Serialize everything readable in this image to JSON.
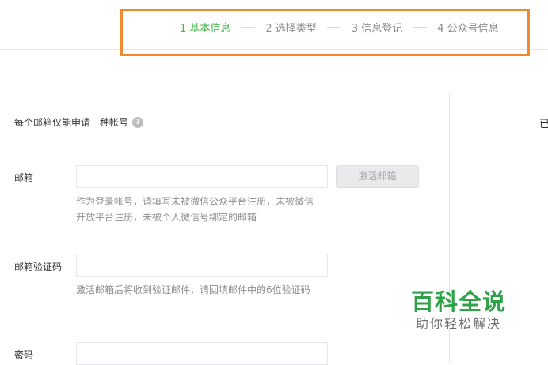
{
  "steps": [
    {
      "label": "1 基本信息",
      "active": true
    },
    {
      "label": "2 选择类型",
      "active": false
    },
    {
      "label": "3 信息登记",
      "active": false
    },
    {
      "label": "4 公众号信息",
      "active": false
    }
  ],
  "notice": {
    "text": "每个邮箱仅能申请一种帐号",
    "help_glyph": "?"
  },
  "side_text": "已",
  "form": {
    "email": {
      "label": "邮箱",
      "value": "",
      "placeholder": "",
      "activate_button": "激活邮箱",
      "tip": "作为登录帐号，请填写未被微信公众平台注册，未被微信开放平台注册，未被个人微信号绑定的邮箱"
    },
    "verify_code": {
      "label": "邮箱验证码",
      "value": "",
      "placeholder": "",
      "tip": "激活邮箱后将收到验证邮件，请回填邮件中的6位验证码"
    },
    "password": {
      "label": "密码",
      "value": "",
      "placeholder": ""
    }
  },
  "watermark": {
    "title": "百科全说",
    "subtitle": "助你轻松解决"
  },
  "colors": {
    "active_step": "#44b549",
    "inactive_step": "#8d8d8d",
    "highlight_border": "#f08a31",
    "watermark_green": "#2fa248"
  }
}
